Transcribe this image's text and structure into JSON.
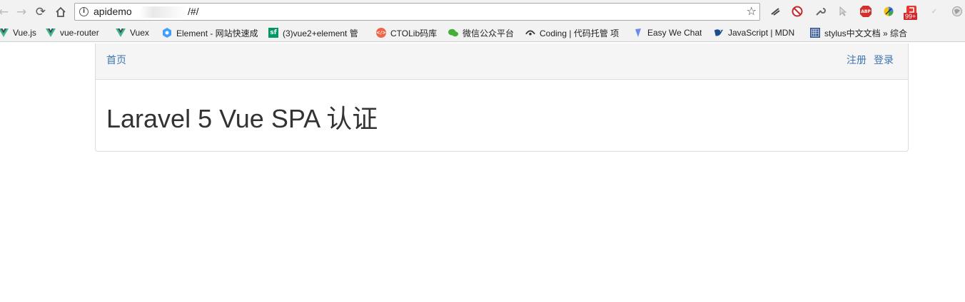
{
  "browser": {
    "url_prefix": "apidemo",
    "url_suffix": "/#/",
    "bookmarks": [
      {
        "label": "Vue.js",
        "icon": "vue-icon"
      },
      {
        "label": "vue-router",
        "icon": "vue-icon"
      },
      {
        "label": "Vuex",
        "icon": "vue-icon"
      },
      {
        "label": "Element - 网站快速成",
        "icon": "element-icon"
      },
      {
        "label": "(3)vue2+element 管",
        "icon": "segmentfault-icon"
      },
      {
        "label": "CTOLib码库",
        "icon": "ctolib-icon"
      },
      {
        "label": "微信公众平台",
        "icon": "wechat-icon"
      },
      {
        "label": "Coding | 代码托管 项",
        "icon": "coding-icon"
      },
      {
        "label": "Easy We Chat",
        "icon": "easywechat-icon"
      },
      {
        "label": "JavaScript | MDN",
        "icon": "mdn-icon"
      },
      {
        "label": "stylus中文文档 » 综合",
        "icon": "stylus-icon"
      }
    ],
    "extension_badge": "99+",
    "adblock_label": "ABP"
  },
  "navbar": {
    "home": "首页",
    "register": "注册",
    "login": "登录"
  },
  "main": {
    "title": "Laravel 5 Vue SPA 认证"
  },
  "colors": {
    "link": "#3c76b4",
    "vue_green": "#41b883",
    "panel_heading": "#f5f5f5"
  }
}
